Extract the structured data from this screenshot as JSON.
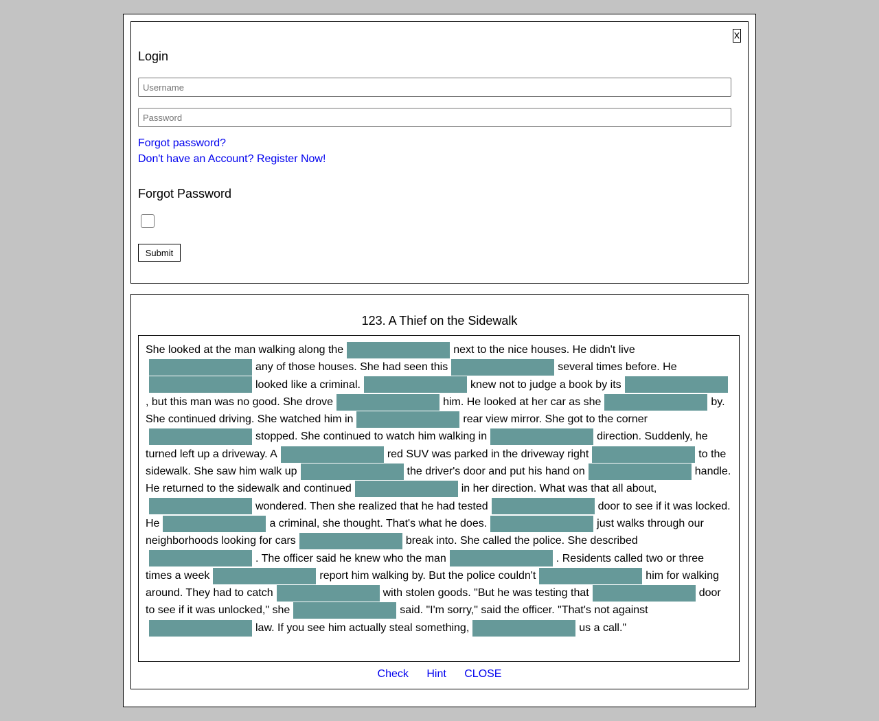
{
  "login": {
    "close_label": "x",
    "title": "Login",
    "username_placeholder": "Username",
    "password_placeholder": "Password",
    "forgot_link": "Forgot password?",
    "register_link": "Don't have an Account? Register Now!",
    "forgot_title": "Forgot Password",
    "submit_label": "Submit"
  },
  "story": {
    "title": "123. A Thief on the Sidewalk",
    "segments": [
      "She looked at the man walking along the",
      "next to the nice houses. He didn't live",
      "any of those houses. She had seen this",
      "several times before. He",
      "looked like a criminal.",
      "knew not to judge a book by its",
      ", but this man was no good. She drove",
      "him. He looked at her car as she",
      "by. She continued driving. She watched him in",
      "rear view mirror. She got to the corner",
      "stopped. She continued to watch him walking in",
      "direction. Suddenly, he turned left up a driveway. A",
      "red SUV was parked in the driveway right",
      "to the sidewalk. She saw him walk up",
      "the driver's door and put his hand on",
      "handle. He returned to the sidewalk and continued",
      "in her direction. What was that all about,",
      "wondered. Then she realized that he had tested",
      "door to see if it was locked. He",
      "a criminal, she thought. That's what he does.",
      "just walks through our neighborhoods looking for cars",
      "break into. She called the police. She described",
      ". The officer said he knew who the man",
      ". Residents called two or three times a week",
      "report him walking by. But the police couldn't",
      "him for walking around. They had to catch",
      "with stolen goods. \"But he was testing that",
      "door to see if it was unlocked,\" she",
      "said. \"I'm sorry,\" said the officer. \"That's not against",
      "law. If you see him actually steal something,",
      "us a call.\""
    ]
  },
  "actions": {
    "check": "Check",
    "hint": "Hint",
    "close": "CLOSE"
  },
  "colors": {
    "blank_fill": "#669999",
    "link": "#0000ee",
    "page_bg": "#c3c3c3"
  }
}
